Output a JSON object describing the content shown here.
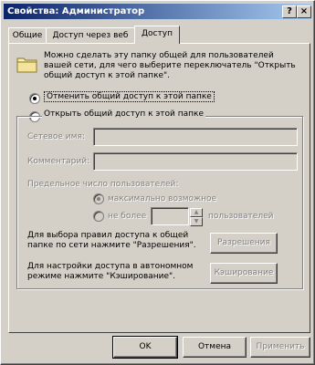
{
  "window": {
    "title": "Свойства: Администратор"
  },
  "title_buttons": {
    "help": "?",
    "close": "×"
  },
  "tabs": [
    {
      "label": "Общие"
    },
    {
      "label": "Доступ через веб"
    },
    {
      "label": "Доступ"
    }
  ],
  "info": {
    "text": "Можно сделать эту папку общей для пользователей вашей сети, для чего выберите переключатель \"Открыть общий доступ к этой папке\"."
  },
  "options": {
    "no_share": {
      "label": "Отменить общий доступ к этой папке",
      "selected": true
    },
    "share": {
      "label": "Открыть общий доступ к этой папке",
      "selected": false
    }
  },
  "share_name": {
    "label": "Сетевое имя:",
    "value": ""
  },
  "comment": {
    "label": "Комментарий:",
    "value": ""
  },
  "user_limit": {
    "label": "Предельное число пользователей:",
    "max_label": "максимально возможное",
    "not_more_label": "не более",
    "users_label": "пользователей",
    "value": ""
  },
  "permissions": {
    "text": "Для выбора правил доступа к общей папке по сети нажмите \"Разрешения\".",
    "button": "Разрешения"
  },
  "caching": {
    "text": "Для настройки доступа в автономном режиме нажмите \"Кэширование\".",
    "button": "Кэширование"
  },
  "footer": {
    "ok": "OK",
    "cancel": "Отмена",
    "apply": "Применить"
  }
}
